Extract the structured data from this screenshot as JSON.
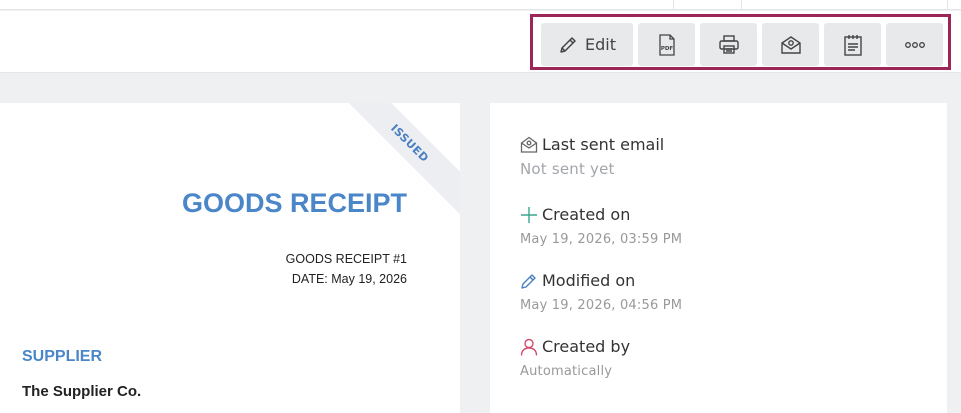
{
  "toolbar": {
    "edit_label": "Edit",
    "frame_color": "#9c2657",
    "buttons": [
      {
        "name": "edit-button",
        "icon": "pencil-icon"
      },
      {
        "name": "pdf-button",
        "icon": "pdf-file-icon"
      },
      {
        "name": "print-button",
        "icon": "printer-icon"
      },
      {
        "name": "email-button",
        "icon": "envelope-icon"
      },
      {
        "name": "notes-button",
        "icon": "notepad-icon"
      },
      {
        "name": "more-button",
        "icon": "more-dots-icon"
      }
    ]
  },
  "document": {
    "status_ribbon": "ISSUED",
    "title": "GOODS RECEIPT",
    "number": "GOODS RECEIPT #1",
    "date": "DATE: May 19, 2026",
    "supplier_heading": "SUPPLIER",
    "supplier_name": "The Supplier Co.",
    "accent_color": "#4a86c8"
  },
  "info": {
    "last_sent": {
      "label": "Last sent email",
      "value": "Not sent yet",
      "icon": "envelope-icon"
    },
    "created_on": {
      "label": "Created on",
      "value": "May 19, 2026, 03:59 PM",
      "icon": "plus-icon"
    },
    "modified_on": {
      "label": "Modified on",
      "value": "May 19, 2026, 04:56 PM",
      "icon": "pencil-icon"
    },
    "created_by": {
      "label": "Created by",
      "value": "Automatically",
      "icon": "user-icon"
    }
  }
}
